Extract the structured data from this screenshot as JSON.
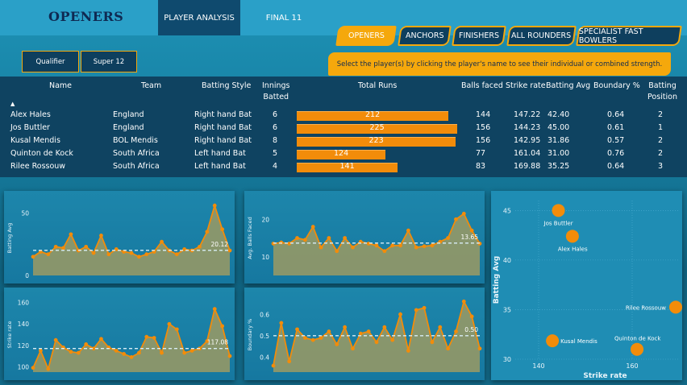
{
  "app": {
    "title": "OPENERS"
  },
  "nav": {
    "tabs": [
      {
        "label": "PLAYER ANALYSIS",
        "active": true
      },
      {
        "label": "FINAL 11",
        "active": false
      }
    ]
  },
  "categories": [
    {
      "label": "OPENERS",
      "active": true
    },
    {
      "label": "ANCHORS",
      "active": false
    },
    {
      "label": "FINISHERS",
      "active": false
    },
    {
      "label": "ALL ROUNDERS",
      "active": false
    },
    {
      "label": "SPECIALIST FAST BOWLERS",
      "active": false
    }
  ],
  "stages": [
    {
      "label": "Qualifier"
    },
    {
      "label": "Super 12"
    }
  ],
  "hint": "Select the player(s) by clicking the player's name to see their individual or combined strength.",
  "colors": {
    "accent": "#f5a80c",
    "bar": "#f28c0a",
    "navy": "#0f2a52",
    "table_bg": "#0f4361"
  },
  "table": {
    "sort_indicator": "▲",
    "headers": {
      "name": "Name",
      "team": "Team",
      "style": "Batting Style",
      "innings_1": "Innings",
      "innings_2": "Batted",
      "runs": "Total Runs",
      "balls": "Balls faced",
      "sr": "Strike rate",
      "avg": "Batting Avg",
      "boundary": "Boundary %",
      "pos_1": "Batting",
      "pos_2": "Position"
    },
    "rows": [
      {
        "name": "Alex Hales",
        "team": "England",
        "style": "Right hand Bat",
        "innings": "6",
        "runs": 212,
        "runs_label": "212",
        "balls": "144",
        "sr": "147.22",
        "avg": "42.40",
        "boundary": "0.64",
        "pos": "2"
      },
      {
        "name": "Jos Buttler",
        "team": "England",
        "style": "Right hand Bat",
        "innings": "6",
        "runs": 225,
        "runs_label": "225",
        "balls": "156",
        "sr": "144.23",
        "avg": "45.00",
        "boundary": "0.61",
        "pos": "1"
      },
      {
        "name": "Kusal Mendis",
        "team": "BOL Mendis",
        "style": "Right hand Bat",
        "innings": "8",
        "runs": 223,
        "runs_label": "223",
        "balls": "156",
        "sr": "142.95",
        "avg": "31.86",
        "boundary": "0.57",
        "pos": "2"
      },
      {
        "name": "Quinton de Kock",
        "team": "South Africa",
        "style": "Left hand Bat",
        "innings": "5",
        "runs": 124,
        "runs_label": "124",
        "balls": "77",
        "sr": "161.04",
        "avg": "31.00",
        "boundary": "0.76",
        "pos": "2"
      },
      {
        "name": "Rilee Rossouw",
        "team": "South Africa",
        "style": "Left hand Bat",
        "innings": "4",
        "runs": 141,
        "runs_label": "141",
        "balls": "83",
        "sr": "169.88",
        "avg": "35.25",
        "boundary": "0.64",
        "pos": "3"
      }
    ]
  },
  "chart_data": [
    {
      "type": "area",
      "ylabel": "Batting Avg",
      "yticks": [
        "0",
        "50"
      ],
      "ylim": [
        0,
        60
      ],
      "avg_line": 20.12,
      "avg_label": "20.12",
      "values": [
        15,
        19,
        17,
        23,
        22,
        33,
        20,
        23,
        18,
        32,
        17,
        21,
        19,
        18,
        15,
        17,
        19,
        27,
        20,
        17,
        21,
        20,
        23,
        35,
        56,
        37,
        20
      ]
    },
    {
      "type": "area",
      "ylabel": "Avg. Balls Faced",
      "yticks": [
        "10",
        "20"
      ],
      "ylim": [
        5,
        25
      ],
      "avg_line": 13.65,
      "avg_label": "13.65",
      "values": [
        13.5,
        13.8,
        13.5,
        15,
        14.5,
        18,
        12.5,
        15,
        11.5,
        15,
        12.5,
        14,
        13.5,
        13,
        11.5,
        13,
        13,
        17,
        12.5,
        12.8,
        13,
        14,
        15,
        20,
        21.5,
        17,
        13.5
      ]
    },
    {
      "type": "area",
      "ylabel": "Strike rate",
      "yticks": [
        "100",
        "120",
        "140",
        "160"
      ],
      "ylim": [
        95,
        165
      ],
      "avg_line": 117.08,
      "avg_label": "117.08",
      "values": [
        99,
        115,
        98,
        125,
        118,
        114,
        113,
        121,
        117,
        126,
        118,
        115,
        112,
        109,
        113,
        128,
        127,
        113,
        140,
        135,
        113,
        115,
        117,
        124,
        154,
        138,
        110
      ]
    },
    {
      "type": "area",
      "ylabel": "Boundary %",
      "yticks": [
        "0.4",
        "0.5",
        "0.6"
      ],
      "ylim": [
        0.33,
        0.68
      ],
      "avg_line": 0.5,
      "avg_label": "0.50",
      "values": [
        0.36,
        0.56,
        0.38,
        0.53,
        0.49,
        0.48,
        0.49,
        0.52,
        0.46,
        0.54,
        0.44,
        0.51,
        0.52,
        0.47,
        0.54,
        0.48,
        0.6,
        0.43,
        0.62,
        0.63,
        0.47,
        0.54,
        0.44,
        0.52,
        0.66,
        0.59,
        0.44
      ]
    },
    {
      "type": "scatter",
      "xlabel": "Strike rate",
      "ylabel": "Batting Avg",
      "xlim": [
        135,
        170
      ],
      "ylim": [
        30,
        46
      ],
      "xticks": [
        "140",
        "160"
      ],
      "yticks": [
        "30",
        "35",
        "40",
        "45"
      ],
      "points": [
        {
          "label": "Jos Buttler",
          "x": 144.23,
          "y": 45.0
        },
        {
          "label": "Alex Hales",
          "x": 147.22,
          "y": 42.4
        },
        {
          "label": "Rilee Rossouw",
          "x": 169.88,
          "y": 35.25
        },
        {
          "label": "Kusal Mendis",
          "x": 142.95,
          "y": 31.86
        },
        {
          "label": "Quinton de Kock",
          "x": 161.04,
          "y": 31.0
        }
      ]
    }
  ]
}
